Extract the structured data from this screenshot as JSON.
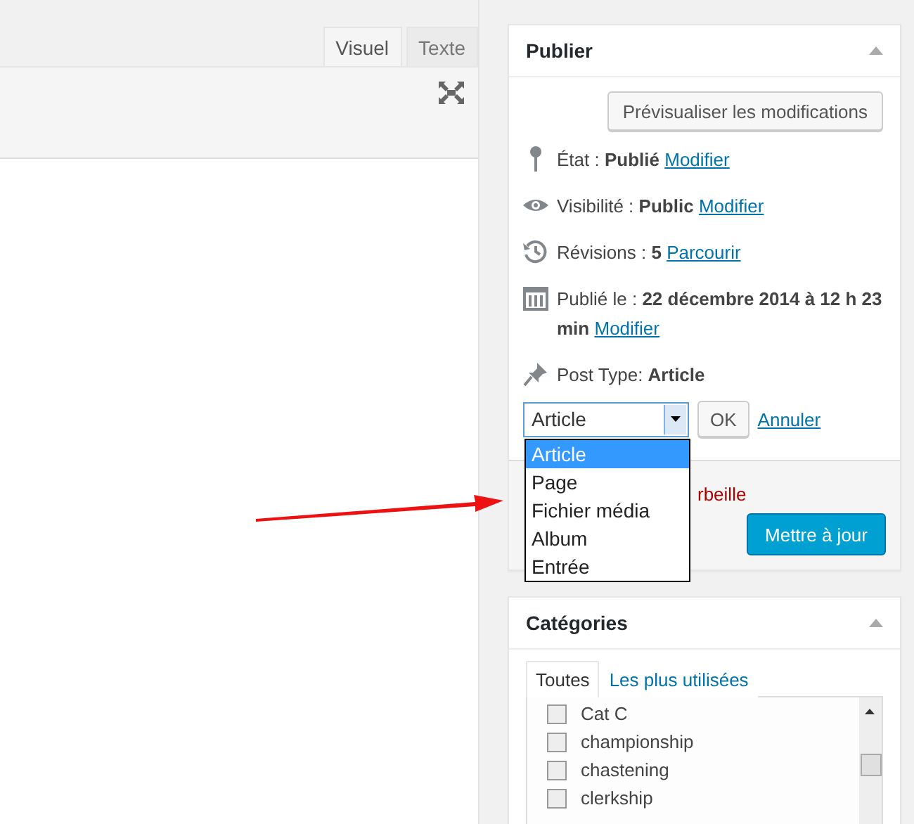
{
  "editor": {
    "tabs": [
      {
        "label": "Visuel",
        "selected": true
      },
      {
        "label": "Texte",
        "selected": false
      }
    ]
  },
  "publish": {
    "title": "Publier",
    "preview_button": "Prévisualiser les modifications",
    "rows": [
      {
        "kind": "pin",
        "label": "État : ",
        "value": "Publié",
        "link": "Modifier"
      },
      {
        "kind": "eye",
        "label": "Visibilité : ",
        "value": "Public",
        "link": "Modifier"
      },
      {
        "kind": "history",
        "label": "Révisions : ",
        "value": "5",
        "link": "Parcourir"
      },
      {
        "kind": "calendar",
        "label": "Publié le : ",
        "value": "22 décembre 2014 à 12 h 23 min",
        "link": "Modifier"
      },
      {
        "kind": "thumbtack",
        "label": "Post Type: ",
        "value": "Article"
      }
    ],
    "select": {
      "value": "Article",
      "expanded": true,
      "options": [
        {
          "label": "Article",
          "selected": true
        },
        {
          "label": "Page",
          "selected": false
        },
        {
          "label": "Fichier média",
          "selected": false
        },
        {
          "label": "Album",
          "selected": false
        },
        {
          "label": "Entrée",
          "selected": false
        }
      ]
    },
    "ok_button": "OK",
    "cancel_link": "Annuler",
    "trash_link": "rbeille",
    "update_button": "Mettre à jour"
  },
  "categories": {
    "title": "Catégories",
    "tabs": [
      {
        "label": "Toutes",
        "selected": true
      },
      {
        "label": "Les plus utilisées",
        "selected": false
      }
    ],
    "items": [
      {
        "label": "Cat C",
        "checked": false
      },
      {
        "label": "championship",
        "checked": false
      },
      {
        "label": "chastening",
        "checked": false
      },
      {
        "label": "clerkship",
        "checked": false
      }
    ]
  }
}
